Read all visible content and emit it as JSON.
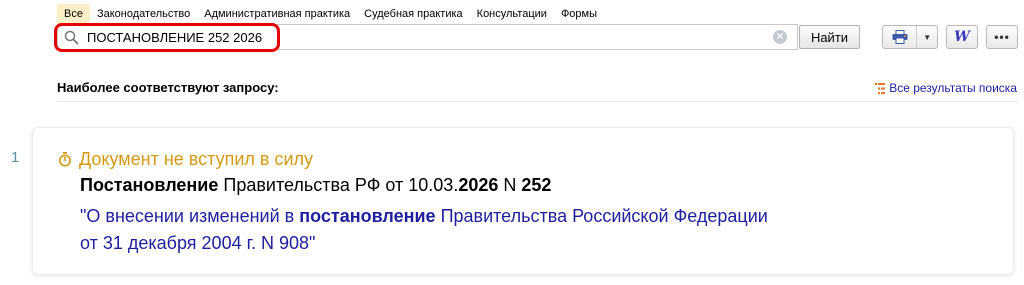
{
  "tabs": [
    "Все",
    "Законодательство",
    "Административная практика",
    "Судебная практика",
    "Консультации",
    "Формы"
  ],
  "search": {
    "value": "ПОСТАНОВЛЕНИЕ 252 2026",
    "button_label": "Найти"
  },
  "toolbar": {
    "word_label": "W",
    "more_label": "•••"
  },
  "best_match": {
    "title": "Наиболее соответствуют запросу:",
    "all_results_link": "Все результаты поиска"
  },
  "result": {
    "number": "1",
    "status": "Документ не вступил в силу",
    "title_parts": {
      "t1": "Постановление",
      "t2": " Правительства РФ от 10.03.",
      "t3": "2026",
      "t4": " N ",
      "t5": "252"
    },
    "link_line1_parts": {
      "l1": "\"О внесении изменений в ",
      "l2": "постановление",
      "l3": " Правительства Российской Федерации"
    },
    "link_line2": "от 31 декабря 2004 г. N 908\""
  },
  "colors": {
    "tab_active_bg": "#fdf0c8",
    "highlight": "#e20000",
    "link": "#1e1e9e",
    "status": "#d39a13",
    "result_number": "#5b8fa1"
  },
  "icons": [
    "search-icon",
    "clear-icon",
    "printer-icon",
    "dropdown-arrow-icon",
    "word-icon",
    "more-icon",
    "list-icon",
    "timer-icon"
  ]
}
